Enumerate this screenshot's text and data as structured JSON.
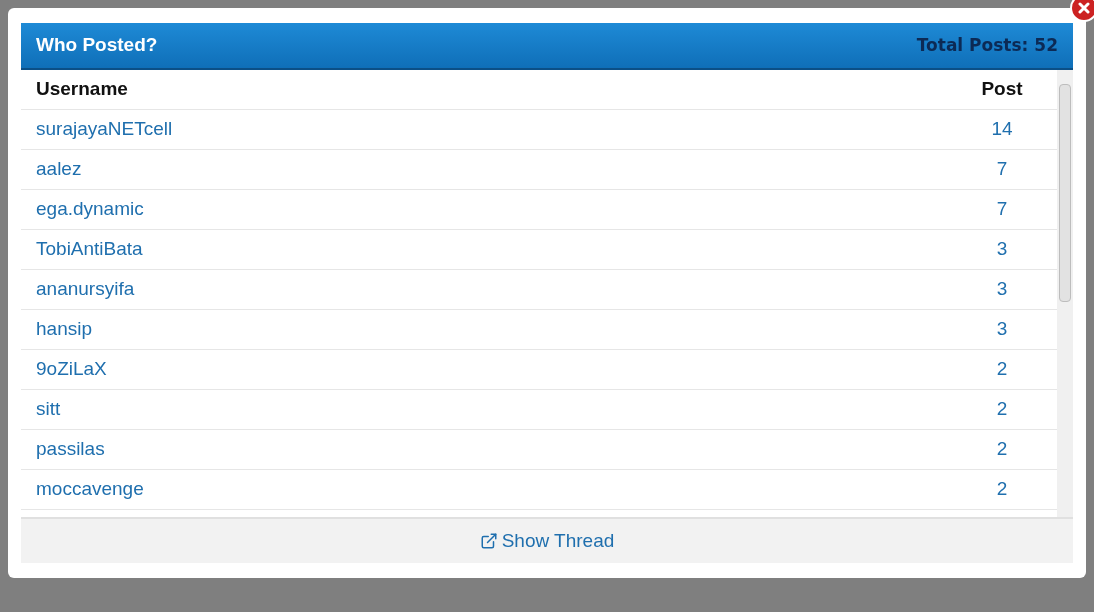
{
  "dialog": {
    "title": "Who Posted?",
    "total": "Total Posts: 52"
  },
  "table": {
    "columns": [
      "Username",
      "Post"
    ],
    "rows": [
      {
        "username": "surajayaNETcell",
        "posts": "14"
      },
      {
        "username": "aalez",
        "posts": "7"
      },
      {
        "username": "ega.dynamic",
        "posts": "7"
      },
      {
        "username": "TobiAntiBata",
        "posts": "3"
      },
      {
        "username": "ananursyifa",
        "posts": "3"
      },
      {
        "username": "hansip",
        "posts": "3"
      },
      {
        "username": "9oZiLaX",
        "posts": "2"
      },
      {
        "username": "sitt",
        "posts": "2"
      },
      {
        "username": "passilas",
        "posts": "2"
      },
      {
        "username": "moccavenge",
        "posts": "2"
      }
    ]
  },
  "footer": {
    "link": "Show Thread"
  }
}
